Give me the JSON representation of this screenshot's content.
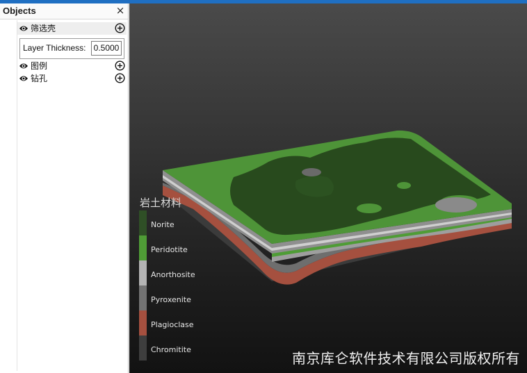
{
  "panel": {
    "title": "Objects",
    "close": "×",
    "items": [
      {
        "label": "筛选壳",
        "visible": true,
        "selected": true
      },
      {
        "label": "图例",
        "visible": true,
        "selected": false
      },
      {
        "label": "钻孔",
        "visible": true,
        "selected": false
      }
    ],
    "property": {
      "label": "Layer Thickness:",
      "value": "0.5000"
    }
  },
  "viewport": {
    "legend": {
      "title": "岩土材料",
      "entries": [
        {
          "label": "Norite",
          "color": "#2f4f26"
        },
        {
          "label": "Peridotite",
          "color": "#4f9c36"
        },
        {
          "label": "Anorthosite",
          "color": "#b3b3b3"
        },
        {
          "label": "Pyroxenite",
          "color": "#737373"
        },
        {
          "label": "Plagioclase",
          "color": "#a5503f"
        },
        {
          "label": "Chromitite",
          "color": "#3e3e3e"
        }
      ]
    },
    "watermark": "南京库仑软件技术有限公司版权所有"
  },
  "colors": {
    "accent": "#1f6fc2"
  }
}
